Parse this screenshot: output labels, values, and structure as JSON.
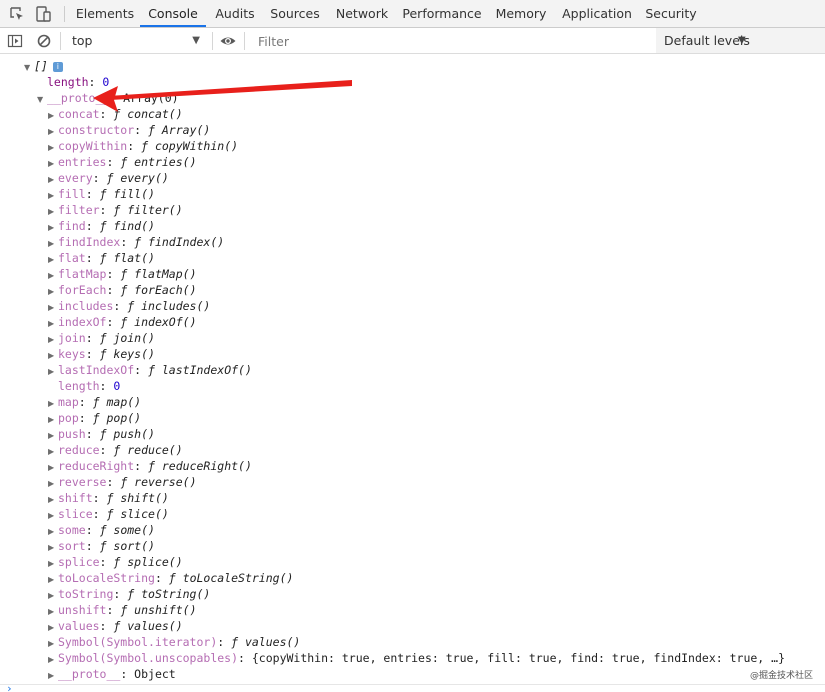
{
  "tabs": [
    {
      "label": "Elements",
      "active": false
    },
    {
      "label": "Console",
      "active": true
    },
    {
      "label": "Audits",
      "active": false
    },
    {
      "label": "Sources",
      "active": false
    },
    {
      "label": "Network",
      "active": false
    },
    {
      "label": "Performance",
      "active": false
    },
    {
      "label": "Memory",
      "active": false
    },
    {
      "label": "Application",
      "active": false
    },
    {
      "label": "Security",
      "active": false
    }
  ],
  "toolbar": {
    "context": "top",
    "filter_placeholder": "Filter",
    "levels": "Default levels"
  },
  "console": {
    "root": {
      "label": "[]",
      "badge": "i"
    },
    "length_key": "length",
    "length_value": "0",
    "proto": {
      "key": "__proto__",
      "value": "Array(0)"
    },
    "methods": [
      {
        "key": "concat",
        "value": "ƒ concat()"
      },
      {
        "key": "constructor",
        "value": "ƒ Array()"
      },
      {
        "key": "copyWithin",
        "value": "ƒ copyWithin()"
      },
      {
        "key": "entries",
        "value": "ƒ entries()"
      },
      {
        "key": "every",
        "value": "ƒ every()"
      },
      {
        "key": "fill",
        "value": "ƒ fill()"
      },
      {
        "key": "filter",
        "value": "ƒ filter()"
      },
      {
        "key": "find",
        "value": "ƒ find()"
      },
      {
        "key": "findIndex",
        "value": "ƒ findIndex()"
      },
      {
        "key": "flat",
        "value": "ƒ flat()"
      },
      {
        "key": "flatMap",
        "value": "ƒ flatMap()"
      },
      {
        "key": "forEach",
        "value": "ƒ forEach()"
      },
      {
        "key": "includes",
        "value": "ƒ includes()"
      },
      {
        "key": "indexOf",
        "value": "ƒ indexOf()"
      },
      {
        "key": "join",
        "value": "ƒ join()"
      },
      {
        "key": "keys",
        "value": "ƒ keys()"
      },
      {
        "key": "lastIndexOf",
        "value": "ƒ lastIndexOf()"
      },
      {
        "key": "length",
        "value": "0",
        "plain": true
      },
      {
        "key": "map",
        "value": "ƒ map()"
      },
      {
        "key": "pop",
        "value": "ƒ pop()"
      },
      {
        "key": "push",
        "value": "ƒ push()"
      },
      {
        "key": "reduce",
        "value": "ƒ reduce()"
      },
      {
        "key": "reduceRight",
        "value": "ƒ reduceRight()"
      },
      {
        "key": "reverse",
        "value": "ƒ reverse()"
      },
      {
        "key": "shift",
        "value": "ƒ shift()"
      },
      {
        "key": "slice",
        "value": "ƒ slice()"
      },
      {
        "key": "some",
        "value": "ƒ some()"
      },
      {
        "key": "sort",
        "value": "ƒ sort()"
      },
      {
        "key": "splice",
        "value": "ƒ splice()"
      },
      {
        "key": "toLocaleString",
        "value": "ƒ toLocaleString()"
      },
      {
        "key": "toString",
        "value": "ƒ toString()"
      },
      {
        "key": "unshift",
        "value": "ƒ unshift()"
      },
      {
        "key": "values",
        "value": "ƒ values()"
      },
      {
        "key": "Symbol(Symbol.iterator)",
        "value": "ƒ values()"
      },
      {
        "key": "Symbol(Symbol.unscopables)",
        "value": "{copyWithin: true, entries: true, fill: true, find: true, findIndex: true, …}",
        "object": true
      },
      {
        "key": "__proto__",
        "value": "Object",
        "object": true
      }
    ]
  },
  "watermark": "@掘金技术社区"
}
